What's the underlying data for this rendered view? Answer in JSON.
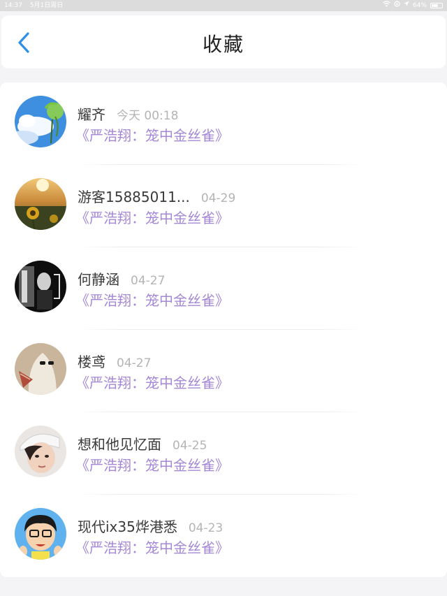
{
  "status_bar": {
    "time": "14:37",
    "date": "5月1日周日",
    "battery_text": "64%",
    "battery_level": 0.64
  },
  "header": {
    "title": "收藏",
    "back_icon": "chevron-left-icon",
    "accent_color": "#2e8fe6"
  },
  "favorites": [
    {
      "name": "耀齐",
      "time": "今天 00:18",
      "content": "《严浩翔：笼中金丝雀》",
      "avatar": "sky-grass-photo"
    },
    {
      "name": "游客15885011...",
      "time": "04-29",
      "content": "《严浩翔：笼中金丝雀》",
      "avatar": "sunflower-sunset-photo"
    },
    {
      "name": "何静涵",
      "time": "04-27",
      "content": "《严浩翔：笼中金丝雀》",
      "avatar": "black-white-portrait-photo"
    },
    {
      "name": "楼鸢",
      "time": "04-27",
      "content": "《严浩翔：笼中金丝雀》",
      "avatar": "masked-figure-photo"
    },
    {
      "name": "想和他见忆面",
      "time": "04-25",
      "content": "《严浩翔：笼中金丝雀》",
      "avatar": "boy-portrait-photo"
    },
    {
      "name": "现代ix35烨港悉",
      "time": "04-23",
      "content": "《严浩翔：笼中金丝雀》",
      "avatar": "cartoon-boy-avatar"
    }
  ],
  "colors": {
    "content_link": "#a488d6",
    "time_text": "#b4b4b4",
    "name_text": "#3a3a3a"
  }
}
